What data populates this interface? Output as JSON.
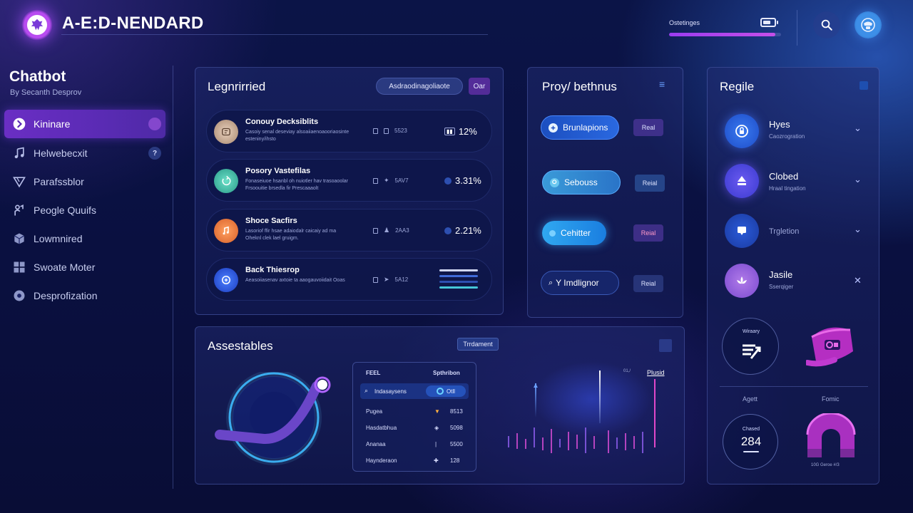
{
  "app": {
    "brand": "A-E:D-NENDARD"
  },
  "header": {
    "status_label": "Ostetinges",
    "progress": 0.95,
    "icons": [
      "battery-icon",
      "search-icon",
      "user-avatar-icon"
    ]
  },
  "sidebar": {
    "title": "Chatbot",
    "subtitle": "By Secanth Desprov",
    "items": [
      {
        "label": "Kininare",
        "icon": "arrow-right-icon",
        "active": true
      },
      {
        "label": "Helwebecxit",
        "icon": "music-icon",
        "badge": "?"
      },
      {
        "label": "Parafssblor",
        "icon": "triangle-icon"
      },
      {
        "label": "Peogle Quuifs",
        "icon": "people-icon"
      },
      {
        "label": "Lowmnired",
        "icon": "cube-icon"
      },
      {
        "label": "Swoate Moter",
        "icon": "grid-icon"
      },
      {
        "label": "Desprofization",
        "icon": "circle-icon"
      }
    ]
  },
  "list_panel": {
    "title": "Legnrirried",
    "filter_pill": "Asdraodinagoliaote",
    "filter_button": "Oar",
    "rows": [
      {
        "title": "Conouy Decksiblits",
        "desc": "Casoiy senal deseviay alsoaiiaenoaooriaosinte esteniny/ihsto",
        "meta": "5523",
        "value": "12%",
        "icon_color": "#c8a890"
      },
      {
        "title": "Posory Vastefilas",
        "desc": "Fonaseiuoe hsanbl oh nuiotler hav trasoaoolar Frsoouitie brsedla fir Prescaaaolt",
        "meta": "5AV7",
        "value": "3.31%",
        "icon_color": "#3fb3a0"
      },
      {
        "title": "Shoce Sacfirs",
        "desc": "Lasoriof ffir hsae adaiodalr caicaiy ad ma Oheknl clek lael gruigm.",
        "meta": "2AA3",
        "value": "2.21%",
        "icon_color": "#e07a3a"
      },
      {
        "title": "Back Thiesrop",
        "desc": "Aeasoiiasenav axtoie ta aaogauvoiidait Ooas",
        "meta": "5A12",
        "value": "",
        "icon_color": "#2d5fe0"
      }
    ]
  },
  "proxy_panel": {
    "title": "Proy/ bethnus",
    "items": [
      {
        "label": "Brunlapions",
        "tag": "Real"
      },
      {
        "label": "Sebouss",
        "tag": "Reial"
      },
      {
        "label": "Cehitter",
        "tag": "Reial"
      },
      {
        "label": "Y Imdlignor",
        "tag": "Reial"
      }
    ]
  },
  "right_panel": {
    "title": "Regile",
    "items": [
      {
        "title": "Hyes",
        "sub": "Caozrogration",
        "chevron": "⌄",
        "icon": "lock-icon"
      },
      {
        "title": "Clobed",
        "sub": "Hraal tingation",
        "chevron": "⌄",
        "icon": "upload-icon"
      },
      {
        "title": "",
        "sub": "Trgletion",
        "chevron": "⌄",
        "icon": "chat-icon"
      },
      {
        "title": "Jasile",
        "sub": "Sserqiger",
        "chevron": "✕",
        "icon": "lotus-icon"
      }
    ],
    "gauge_card": {
      "label": "Wiraary"
    },
    "stats": {
      "left_label": "Agett",
      "right_label": "Fomic",
      "circle_label": "Chased",
      "circle_value": "284",
      "right_caption": "10G Geroe #/3"
    }
  },
  "assets_panel": {
    "title": "Assestables",
    "badge": "Trrdament",
    "table": {
      "col1": "FEEL",
      "col2": "Spthribon",
      "rows": [
        {
          "name": "Indasaysens",
          "value": "Otll",
          "highlight": true
        },
        {
          "name": "Pugea",
          "value": "8513"
        },
        {
          "name": "Hasdatbhua",
          "value": "5098"
        },
        {
          "name": "Ananaa",
          "value": "5500"
        },
        {
          "name": "Haynderaon",
          "value": "128"
        }
      ]
    },
    "chart_labels": {
      "top": "Plusid",
      "mid": "01,/"
    }
  },
  "colors": {
    "accent_purple": "#6a2ec4",
    "accent_blue": "#2f8ff0",
    "background": "#0b1447"
  }
}
